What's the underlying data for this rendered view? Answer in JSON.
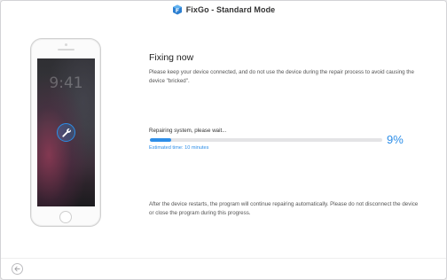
{
  "window": {
    "title": "FixGo - Standard Mode",
    "logo_icon": "fixgo-logo-icon"
  },
  "phone": {
    "clock": "9:41",
    "status_icon": "wrench-icon"
  },
  "main": {
    "heading": "Fixing now",
    "description": "Please keep your device connected, and do not use the device during the repair process to avoid causing the device \"bricked\".",
    "progress": {
      "label": "Repairing system, please wait...",
      "percent_text": "9%",
      "value": 0.09,
      "estimated": "Estimated time: 10 minutes"
    },
    "footer_note": "After the device restarts, the program will continue repairing automatically. Please do not disconnect the device or close the program during this progress."
  },
  "navigation": {
    "back_icon": "back-arrow-icon"
  },
  "colors": {
    "accent": "#2d8ee8",
    "track": "#e4e4e6"
  }
}
